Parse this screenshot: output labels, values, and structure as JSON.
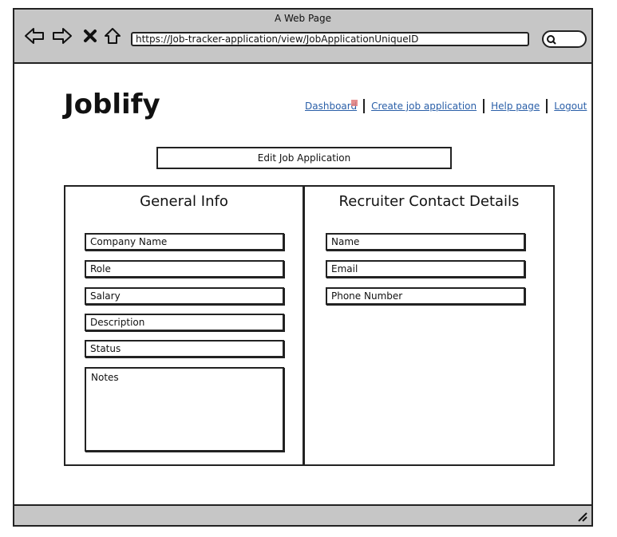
{
  "browser": {
    "window_title": "A Web Page",
    "url": "https://Job-tracker-application/view/JobApplicationUniqueID",
    "icons": [
      "back-arrow-icon",
      "forward-arrow-icon",
      "close-x-icon",
      "home-icon",
      "search-icon"
    ]
  },
  "header": {
    "logo": "Joblify",
    "nav": {
      "dashboard": "Dashboard",
      "create": "Create job application",
      "help": "Help page",
      "logout": "Logout"
    },
    "link_color": "#2a5fa8"
  },
  "actions": {
    "edit_label": "Edit Job Application"
  },
  "general_info": {
    "title": "General Info",
    "fields": {
      "company": "Company Name",
      "role": "Role",
      "salary": "Salary",
      "description": "Description",
      "status": "Status",
      "notes": "Notes"
    }
  },
  "recruiter": {
    "title": "Recruiter Contact Details",
    "fields": {
      "name": "Name",
      "email": "Email",
      "phone": "Phone Number"
    }
  }
}
